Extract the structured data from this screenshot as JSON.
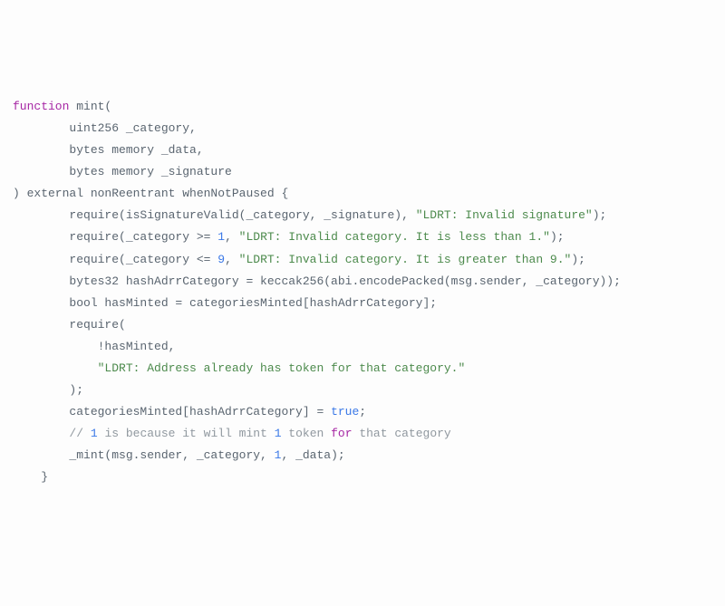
{
  "code": {
    "l1": {
      "kw": "function",
      "name": " mint("
    },
    "l2": "        uint256 _category,",
    "l3": "        bytes memory _data,",
    "l4": "        bytes memory _signature",
    "l5": ") external nonReentrant whenNotPaused {",
    "l6a": "        require(isSignatureValid(_category, _signature), ",
    "l6s": "\"LDRT: Invalid signature\"",
    "l6b": ");",
    "l7a": "        require(_category >= ",
    "l7n": "1",
    "l7b": ", ",
    "l7s": "\"LDRT: Invalid category. It is less than 1.\"",
    "l7c": ");",
    "l8a": "        require(_category <= ",
    "l8n": "9",
    "l8b": ", ",
    "l8s": "\"LDRT: Invalid category. It is greater than 9.\"",
    "l8c": ");",
    "l9": "",
    "l10": "        bytes32 hashAdrrCategory = keccak256(abi.encodePacked(msg.sender, _category));",
    "l11": "        bool hasMinted = categoriesMinted[hashAdrrCategory];",
    "l12": "        require(",
    "l13": "            !hasMinted,",
    "l14s": "            \"LDRT: Address already has token for that category.\"",
    "l15": "        );",
    "l16a": "        categoriesMinted[hashAdrrCategory] = ",
    "l16t": "true",
    "l16b": ";",
    "l17": "",
    "l18a": "        // ",
    "l18n": "1",
    "l18b": " is because it will mint ",
    "l18c": "1",
    "l18d": " token ",
    "l18k": "for",
    "l18e": " that category",
    "l19a": "        _mint(msg.sender, _category, ",
    "l19n": "1",
    "l19b": ", _data);",
    "l20": "    }"
  }
}
